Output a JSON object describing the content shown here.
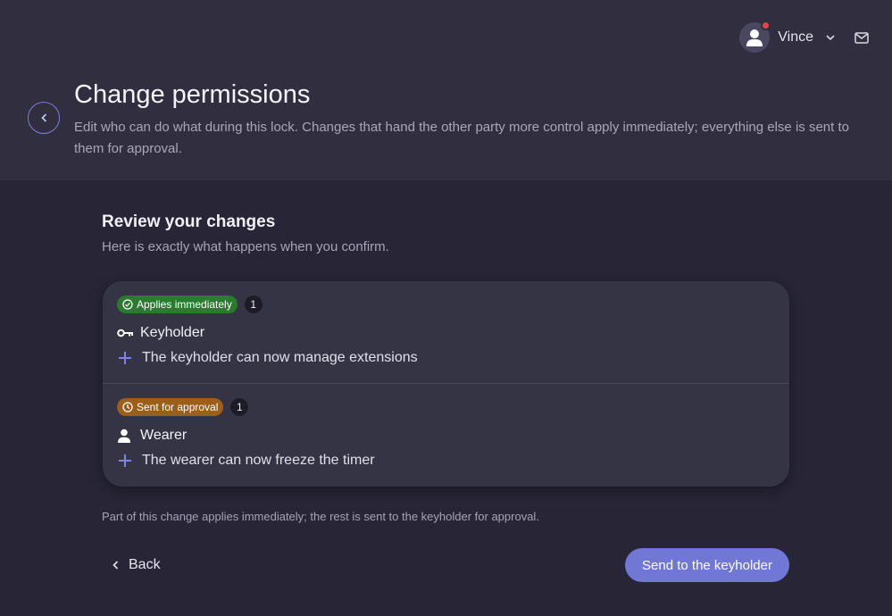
{
  "user": {
    "name": "Vince",
    "avatar_icon": "user-icon",
    "notification": true
  },
  "header": {
    "title": "Change permissions",
    "description": "Edit who can do what during this lock. Changes that hand the other party more control apply immediately; everything else is sent to them for approval."
  },
  "review": {
    "title": "Review your changes",
    "subtitle": "Here is exactly what happens when you confirm.",
    "groups": [
      {
        "badge": "Applies immediately",
        "badge_color": "#2b7b2e",
        "badge_icon": "check-circle-icon",
        "count": "1",
        "role": "Keyholder",
        "role_icon": "key-icon",
        "change": "The keyholder can now manage extensions"
      },
      {
        "badge": "Sent for approval",
        "badge_color": "#9b5f1a",
        "badge_icon": "clock-icon",
        "count": "1",
        "role": "Wearer",
        "role_icon": "person-icon",
        "change": "The wearer can now freeze the timer"
      }
    ]
  },
  "footer": {
    "note": "Part of this change applies immediately; the rest is sent to the keyholder for approval.",
    "back_label": "Back",
    "submit_label": "Send to the keyholder"
  },
  "colors": {
    "accent": "#7077d4",
    "background": "#272536",
    "header": "#302e3f",
    "card": "#353445"
  }
}
